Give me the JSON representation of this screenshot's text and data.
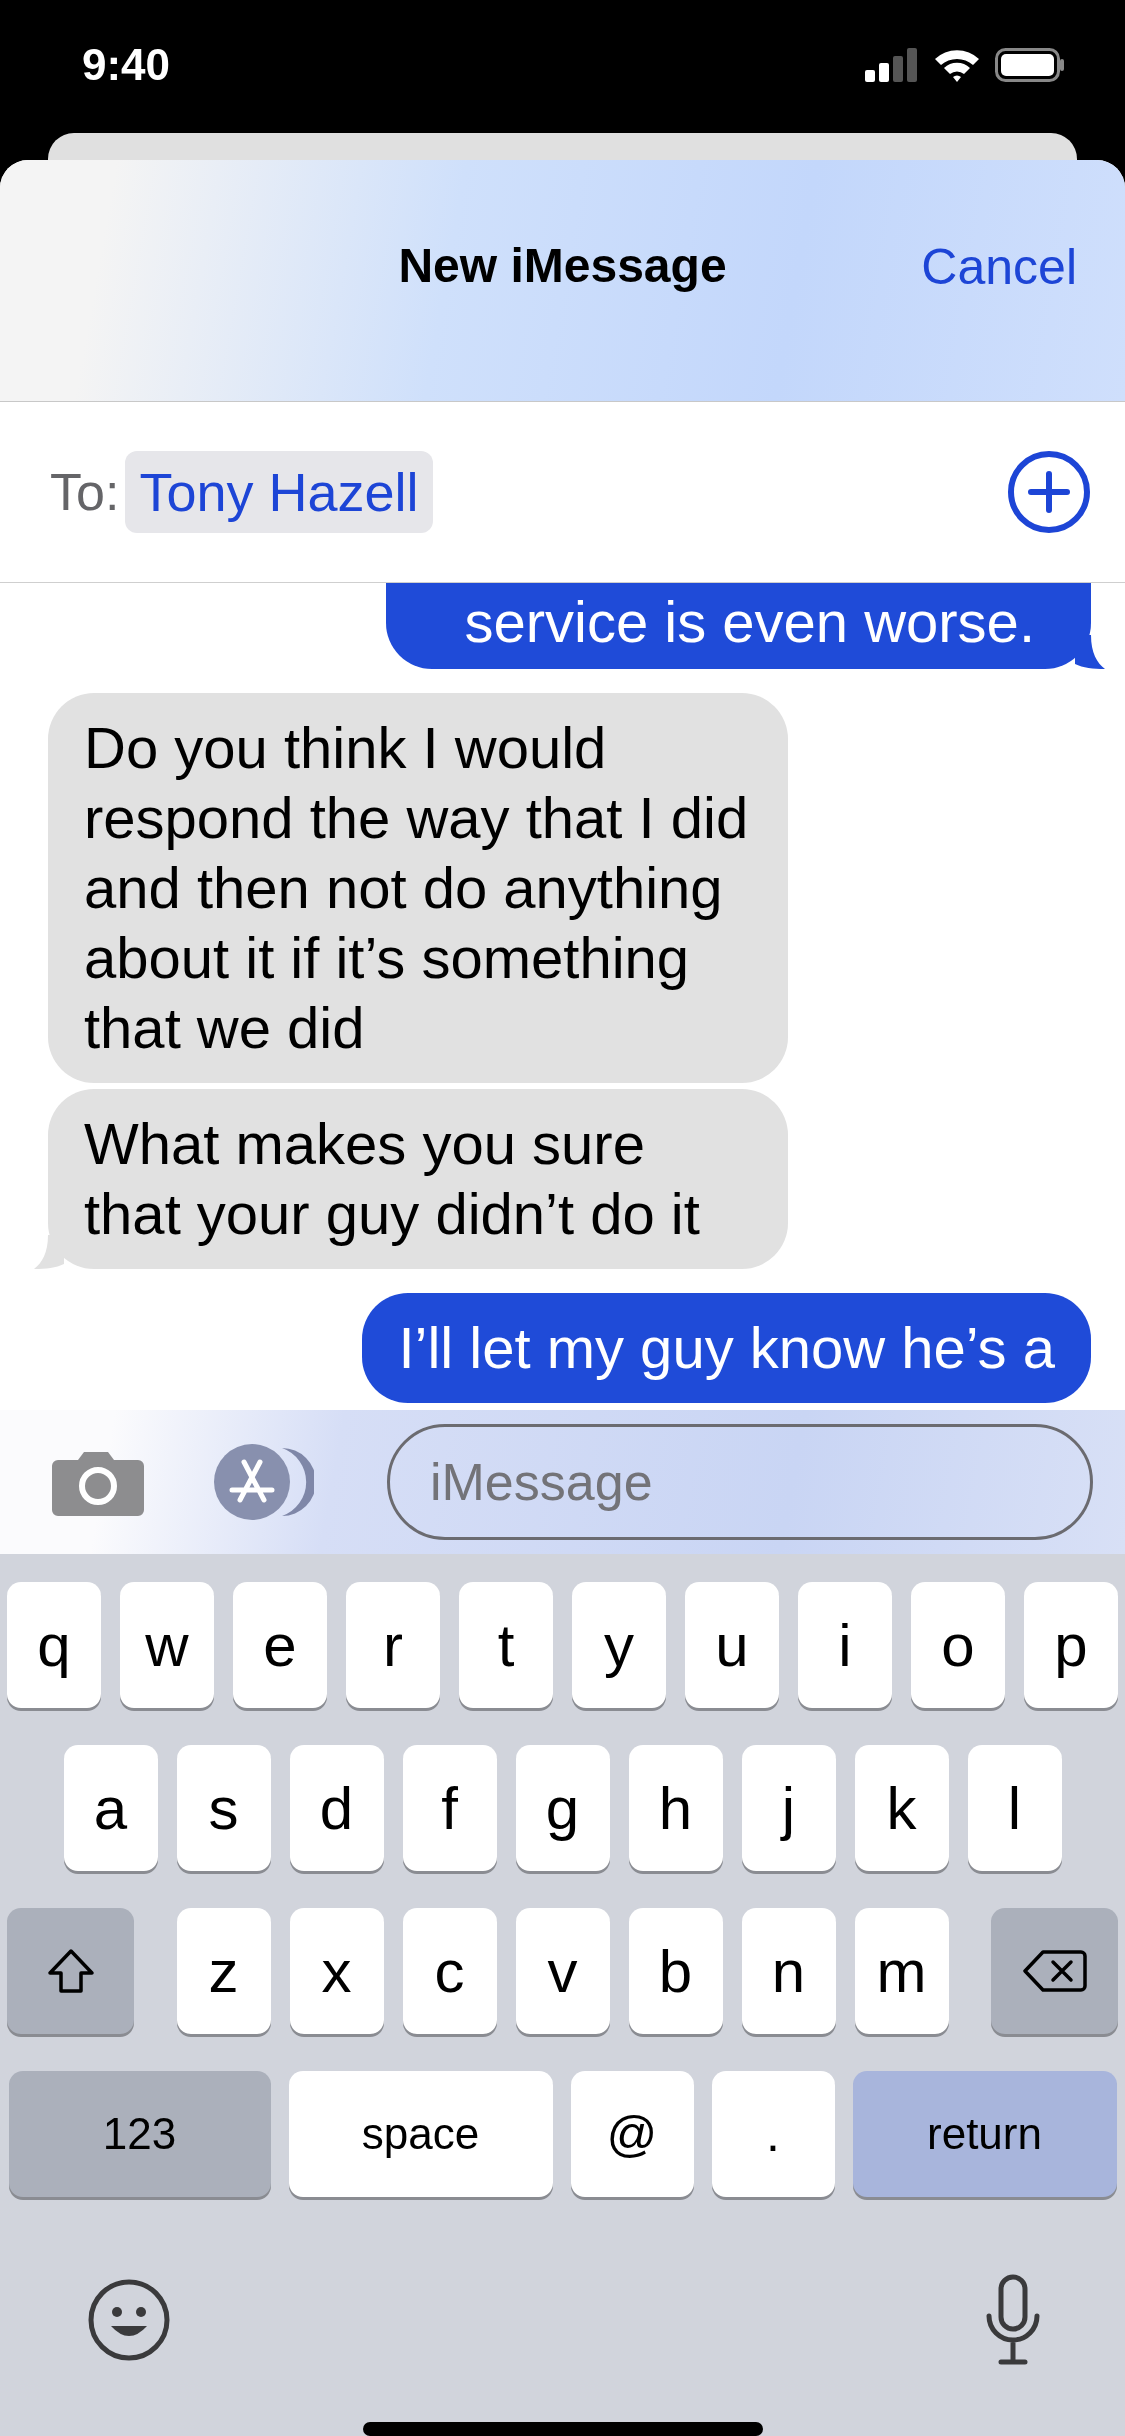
{
  "status_bar": {
    "time": "9:40"
  },
  "header": {
    "title": "New iMessage",
    "cancel": "Cancel"
  },
  "recipient": {
    "label": "To:",
    "name": "Tony Hazell"
  },
  "messages": [
    {
      "text": "service is even worse.",
      "sent": true,
      "tail": true
    },
    {
      "text": "Do you think I would respond the way that I did and then not do anything about it if it’s something that we did",
      "sent": false,
      "tail": false
    },
    {
      "text": "What makes you sure that your guy didn’t do it",
      "sent": false,
      "tail": true
    },
    {
      "text": "I’ll let my guy know he’s a",
      "sent": true,
      "tail": false
    }
  ],
  "compose": {
    "placeholder": "iMessage"
  },
  "keyboard": {
    "rows": [
      {
        "keys": [
          {
            "kind": "letter",
            "label": "q"
          },
          {
            "kind": "letter",
            "label": "w"
          },
          {
            "kind": "letter",
            "label": "e"
          },
          {
            "kind": "letter",
            "label": "r"
          },
          {
            "kind": "letter",
            "label": "t"
          },
          {
            "kind": "letter",
            "label": "y"
          },
          {
            "kind": "letter",
            "label": "u"
          },
          {
            "kind": "letter",
            "label": "i"
          },
          {
            "kind": "letter",
            "label": "o"
          },
          {
            "kind": "letter",
            "label": "p"
          }
        ]
      },
      {
        "keys": [
          {
            "kind": "letter",
            "label": "a"
          },
          {
            "kind": "letter",
            "label": "s"
          },
          {
            "kind": "letter",
            "label": "d"
          },
          {
            "kind": "letter",
            "label": "f"
          },
          {
            "kind": "letter",
            "label": "g"
          },
          {
            "kind": "letter",
            "label": "h"
          },
          {
            "kind": "letter",
            "label": "j"
          },
          {
            "kind": "letter",
            "label": "k"
          },
          {
            "kind": "letter",
            "label": "l"
          }
        ]
      },
      {
        "keys": [
          {
            "kind": "shift"
          },
          {
            "kind": "letter",
            "label": "z"
          },
          {
            "kind": "letter",
            "label": "x"
          },
          {
            "kind": "letter",
            "label": "c"
          },
          {
            "kind": "letter",
            "label": "v"
          },
          {
            "kind": "letter",
            "label": "b"
          },
          {
            "kind": "letter",
            "label": "n"
          },
          {
            "kind": "letter",
            "label": "m"
          },
          {
            "kind": "delete"
          }
        ]
      },
      {
        "keys": [
          {
            "kind": "mode",
            "label": "123"
          },
          {
            "kind": "space",
            "label": "space"
          },
          {
            "kind": "symbol",
            "label": "@"
          },
          {
            "kind": "symbol",
            "label": "."
          },
          {
            "kind": "return",
            "label": "return"
          }
        ]
      }
    ]
  }
}
